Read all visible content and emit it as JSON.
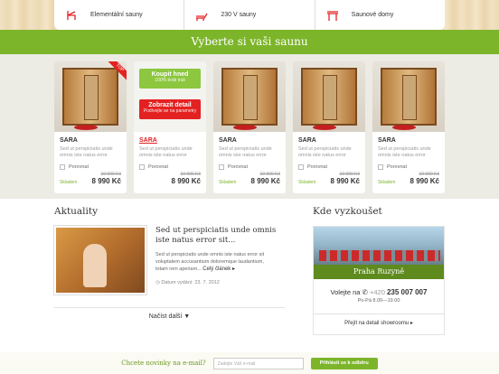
{
  "nav": {
    "items": [
      {
        "label": "Elementální sauny",
        "icon": "chair-icon"
      },
      {
        "label": "230 V sauny",
        "icon": "lounger-icon"
      },
      {
        "label": "Saunové domy",
        "icon": "bench-icon"
      }
    ]
  },
  "band": {
    "title": "Vyberte si vaši saunu"
  },
  "hover_card": {
    "buy_label": "Koupit hned",
    "buy_sub": "100% bráti trali",
    "detail_label": "Zobrazit detail",
    "detail_sub": "Podívejte se na parametry"
  },
  "products": [
    {
      "name": "SARA",
      "desc": "Sed ut perspiciatis unde omnis iste natus error atm...",
      "compare": "Porovnat",
      "stock": "Skladem",
      "old_price": "10 990 Kč",
      "price": "8 990 Kč",
      "badge": "TOP"
    },
    {
      "name": "SARA",
      "desc": "Sed ut perspiciatis unde omnis iste natus error atm...",
      "compare": "Porovnat",
      "stock": "",
      "old_price": "10 990 Kč",
      "price": "8 990 Kč",
      "badge": ""
    },
    {
      "name": "SARA",
      "desc": "Sed ut perspiciatis unde omnis iste natus error atm...",
      "compare": "Porovnat",
      "stock": "Skladem",
      "old_price": "10 990 Kč",
      "price": "8 990 Kč",
      "badge": ""
    },
    {
      "name": "SARA",
      "desc": "Sed ut perspiciatis unde omnis iste natus error atm...",
      "compare": "Porovnat",
      "stock": "Skladem",
      "old_price": "10 990 Kč",
      "price": "8 990 Kč",
      "badge": ""
    },
    {
      "name": "SARA",
      "desc": "Sed ut perspiciatis unde omnis iste natus error atm...",
      "compare": "Porovnat",
      "stock": "Skladem",
      "old_price": "10 990 Kč",
      "price": "8 990 Kč",
      "badge": ""
    }
  ],
  "news": {
    "title": "Aktuality",
    "article_title": "Sed ut perspiciatis unde omnis iste natus error sit...",
    "article_text": "Sed ut perspiciatis unde omnis iste natus error sit voluptatem accusantium doloremque laudantium, totam rem aperiam...",
    "more": "Celý článek",
    "date": "Datum vydání: 23. 7. 2012",
    "load_more": "Načíst další"
  },
  "showroom": {
    "title": "Kde vyzkoušet",
    "place": "Praha Ruzyně",
    "call_label": "Volejte na",
    "phone_prefix": "+420",
    "phone": "235 007 007",
    "hours": "Po-Pá 8.00—19.00",
    "link": "Přejít na detail showroomu"
  },
  "newsletter": {
    "label": "Chcete novinky na e-mail?",
    "placeholder": "Zadejte Váš e-mail",
    "button": "Přihlásit se k odběru"
  },
  "colors": {
    "green": "#7cb52a",
    "red": "#e42121",
    "dark_green": "#5e8a1e"
  }
}
